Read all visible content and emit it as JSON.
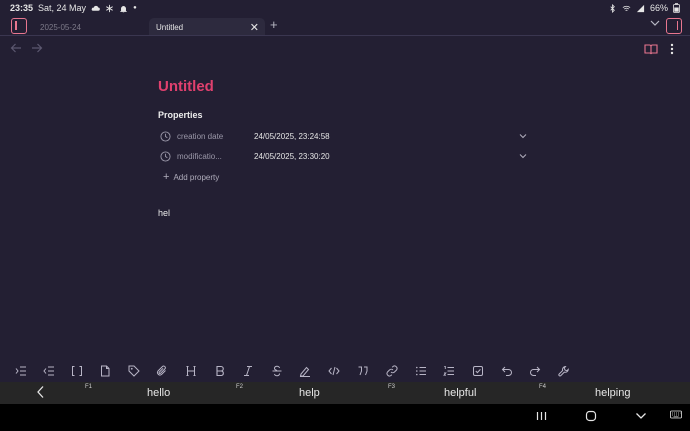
{
  "status_bar": {
    "time": "23:35",
    "date": "Sat, 24 May",
    "battery": "66%"
  },
  "tabs": [
    {
      "label": "2025-05-24"
    },
    {
      "label": "Untitled"
    }
  ],
  "tab_close_glyph": "✕",
  "new_tab_glyph": "+",
  "note": {
    "title": "Untitled",
    "properties_heading": "Properties",
    "properties": [
      {
        "key": "creation date",
        "value": "24/05/2025, 23:24:58"
      },
      {
        "key": "modificatio...",
        "value": "24/05/2025, 23:30:20"
      }
    ],
    "add_property_label": "Add property",
    "body": "hel"
  },
  "keyboard": {
    "suggestions": [
      {
        "fkey": "F1",
        "word": "hello"
      },
      {
        "fkey": "F2",
        "word": "help"
      },
      {
        "fkey": "F3",
        "word": "helpful"
      },
      {
        "fkey": "F4",
        "word": "helping"
      }
    ]
  },
  "colors": {
    "background": "#231f33",
    "accent": "#e0406e",
    "toggle": "#e8768f"
  }
}
